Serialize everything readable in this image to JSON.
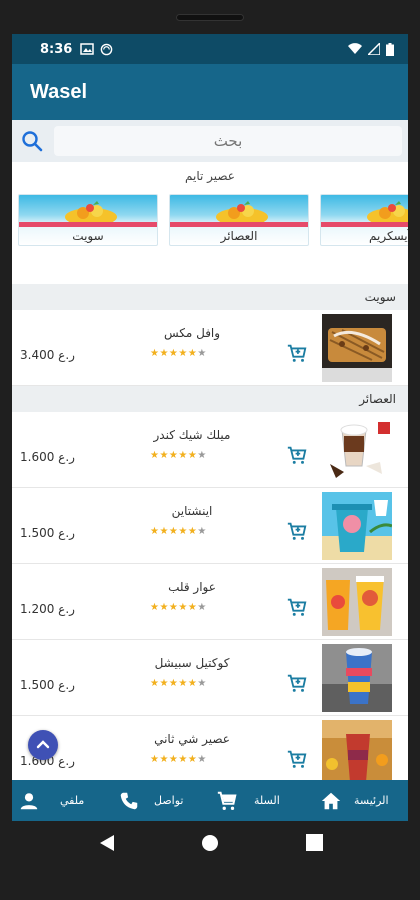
{
  "status": {
    "time": "8:36"
  },
  "app": {
    "title": "Wasel"
  },
  "search": {
    "placeholder": "بحث"
  },
  "categories": {
    "header": "عصير تايم",
    "items": [
      {
        "label": "سويت"
      },
      {
        "label": "العصائر"
      },
      {
        "label": "آيسكريم"
      }
    ]
  },
  "sections": [
    {
      "title": "سويت",
      "products": [
        {
          "name": "وافل مكس",
          "price": "3.400 ر.ع",
          "rating": 5,
          "thumb": "waffle-image"
        }
      ]
    },
    {
      "title": "العصائر",
      "products": [
        {
          "name": "ميلك شيك كندر",
          "price": "1.600 ر.ع",
          "rating": 5,
          "thumb": "milkshake-image"
        },
        {
          "name": "اينشتاين",
          "price": "1.500 ر.ع",
          "rating": 5,
          "thumb": "juice-image"
        },
        {
          "name": "عوار قلب",
          "price": "1.200 ر.ع",
          "rating": 5,
          "thumb": "juice-cups-image"
        },
        {
          "name": "كوكتيل سبيشل",
          "price": "1.500 ر.ع",
          "rating": 5,
          "thumb": "cocktail-image"
        },
        {
          "name": "عصير شي ثاني",
          "price": "1.600 ر.ع",
          "rating": 5,
          "thumb": "juice-shop-image"
        }
      ]
    }
  ],
  "bottom_nav": {
    "home": "الرئيسة",
    "cart": "السلة",
    "contact": "تواصل",
    "profile": "ملفي"
  },
  "colors": {
    "statusbar": "#0e4b66",
    "appbar": "#16668a",
    "fab": "#3f51b5",
    "stars": "#f2b01e"
  }
}
